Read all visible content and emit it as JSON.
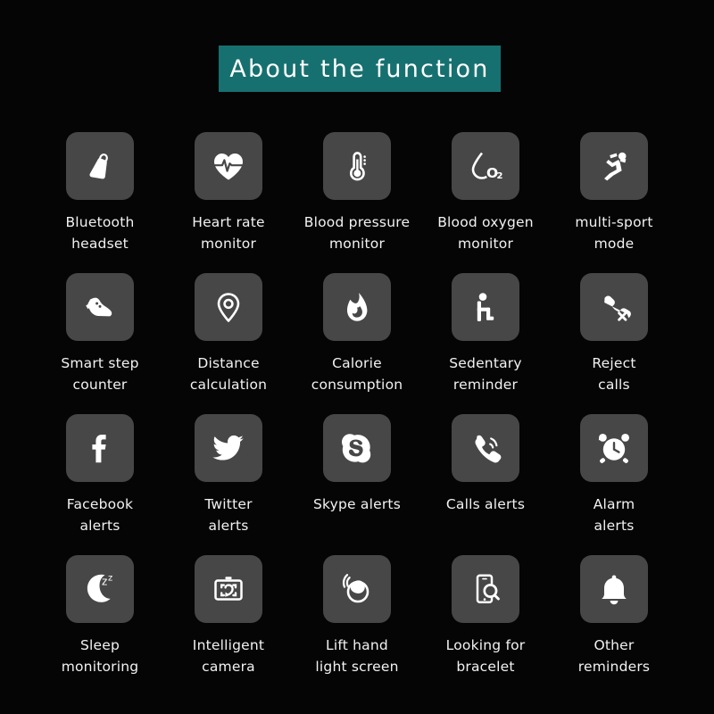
{
  "header": {
    "title": "About  the  function",
    "banner_color": "#177070",
    "title_color": "#ffffff"
  },
  "theme": {
    "background": "#050505",
    "tile_background": "#474747",
    "icon_color": "#ffffff",
    "label_color": "#f2f2f2"
  },
  "grid": {
    "columns": 5,
    "rows": 4,
    "items": [
      {
        "icon": "bluetooth-headset-icon",
        "label": "Bluetooth\nheadset"
      },
      {
        "icon": "heart-rate-icon",
        "label": "Heart rate\nmonitor"
      },
      {
        "icon": "thermometer-icon",
        "label": "Blood pressure\nmonitor"
      },
      {
        "icon": "blood-oxygen-icon",
        "label": "Blood oxygen\nmonitor"
      },
      {
        "icon": "running-person-icon",
        "label": "multi-sport\nmode"
      },
      {
        "icon": "shoe-icon",
        "label": "Smart step\ncounter"
      },
      {
        "icon": "map-pin-icon",
        "label": "Distance\ncalculation"
      },
      {
        "icon": "flame-icon",
        "label": "Calorie\nconsumption"
      },
      {
        "icon": "sitting-person-icon",
        "label": "Sedentary\nreminder"
      },
      {
        "icon": "reject-call-icon",
        "label": "Reject\ncalls"
      },
      {
        "icon": "facebook-icon",
        "label": "Facebook\nalerts"
      },
      {
        "icon": "twitter-icon",
        "label": "Twitter\nalerts"
      },
      {
        "icon": "skype-icon",
        "label": "Skype alerts"
      },
      {
        "icon": "phone-ring-icon",
        "label": "Calls alerts"
      },
      {
        "icon": "alarm-clock-icon",
        "label": "Alarm\nalerts"
      },
      {
        "icon": "moon-zzz-icon",
        "label": "Sleep\nmonitoring"
      },
      {
        "icon": "camera-icon",
        "label": "Intelligent\ncamera"
      },
      {
        "icon": "lift-wrist-icon",
        "label": "Lift hand\nlight screen"
      },
      {
        "icon": "find-bracelet-icon",
        "label": "Looking for\nbracelet"
      },
      {
        "icon": "bell-icon",
        "label": "Other\nreminders"
      }
    ]
  }
}
